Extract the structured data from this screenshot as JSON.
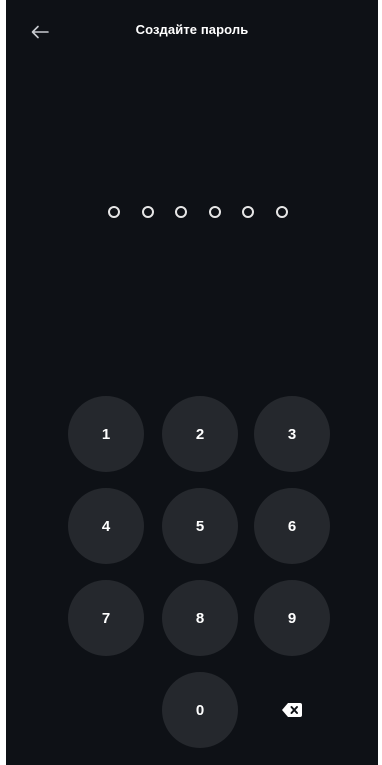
{
  "header": {
    "back_icon": "arrow-left-icon",
    "title": "Создайте пароль"
  },
  "pin": {
    "length": 6,
    "filled": 0
  },
  "keypad": {
    "keys": [
      "1",
      "2",
      "3",
      "4",
      "5",
      "6",
      "7",
      "8",
      "9",
      "0"
    ],
    "delete_icon": "backspace-icon"
  },
  "colors": {
    "background": "#0e1116",
    "key_background": "#25282d",
    "text": "#ffffff",
    "dot_border": "#e6e6e6"
  }
}
